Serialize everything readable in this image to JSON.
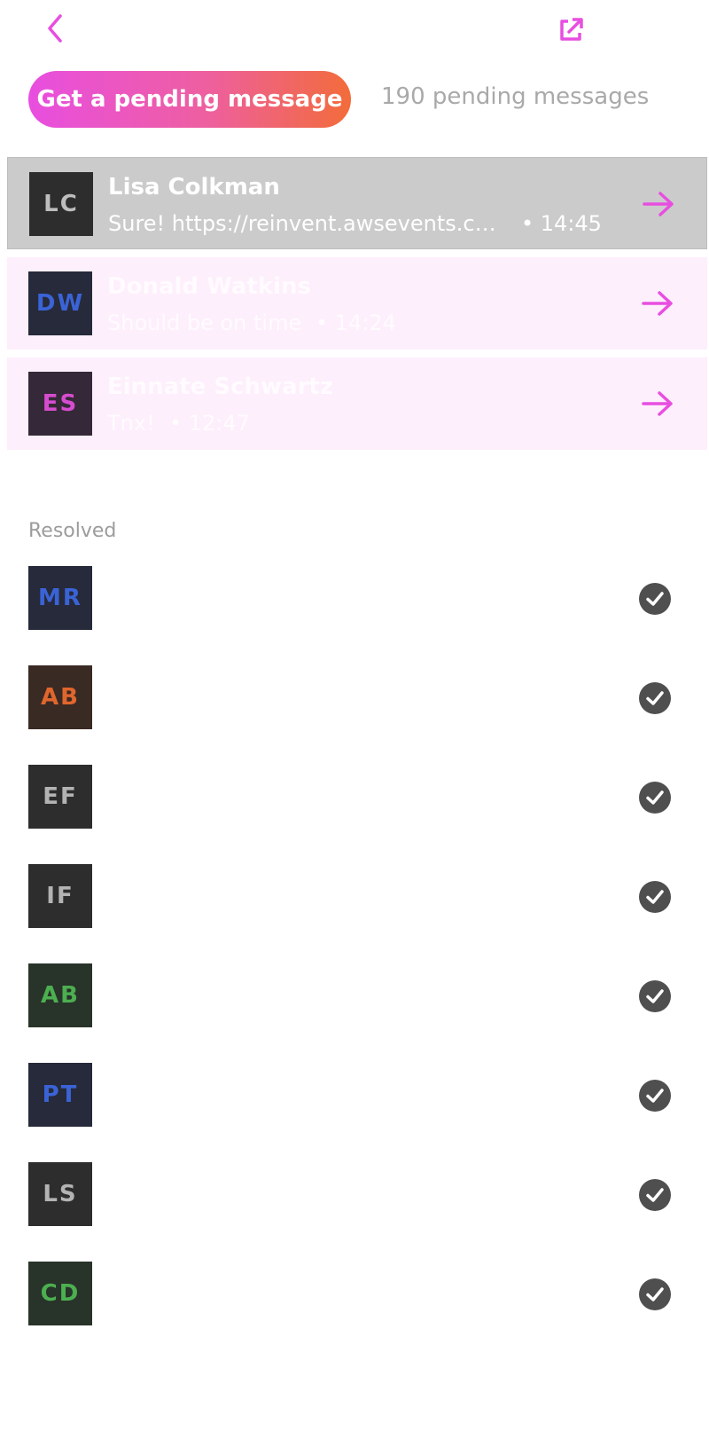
{
  "header": {
    "back_icon": "chevron-left-icon",
    "external_icon": "external-link-icon",
    "accent": "#e84ee0"
  },
  "pending": {
    "button_label": "Get a pending message",
    "count_text": "190 pending messages"
  },
  "conversations": [
    {
      "initials": "LC",
      "name": "Lisa Colkman",
      "preview": "Sure! https://reinvent.awsevents.co…",
      "time": "• 14:45",
      "avatar_bg": "#2d2d2d",
      "avatar_fg": "#bdbdbd",
      "state": "active"
    },
    {
      "initials": "DW",
      "name": "Donald Watkins",
      "preview": "Should be on time",
      "time": "• 14:24",
      "avatar_bg": "#262a3a",
      "avatar_fg": "#3a63d6",
      "state": "pending"
    },
    {
      "initials": "ES",
      "name": "Einnate Schwartz",
      "preview": "Tnx!",
      "time": "• 12:47",
      "avatar_bg": "#352838",
      "avatar_fg": "#d64ccf",
      "state": "pending"
    }
  ],
  "resolved": {
    "label": "Resolved",
    "items": [
      {
        "initials": "MR",
        "avatar_bg": "#262a3a",
        "avatar_fg": "#3a63d6"
      },
      {
        "initials": "AB",
        "avatar_bg": "#3a2a24",
        "avatar_fg": "#e0662d"
      },
      {
        "initials": "EF",
        "avatar_bg": "#2d2d2d",
        "avatar_fg": "#b3b3b3"
      },
      {
        "initials": "IF",
        "avatar_bg": "#2d2d2d",
        "avatar_fg": "#b3b3b3"
      },
      {
        "initials": "AB",
        "avatar_bg": "#28332a",
        "avatar_fg": "#4caf50"
      },
      {
        "initials": "PT",
        "avatar_bg": "#262a3a",
        "avatar_fg": "#3a63d6"
      },
      {
        "initials": "LS",
        "avatar_bg": "#2d2d2d",
        "avatar_fg": "#b3b3b3"
      },
      {
        "initials": "CD",
        "avatar_bg": "#28332a",
        "avatar_fg": "#4caf50"
      }
    ],
    "check_icon": "check-circle-icon"
  }
}
